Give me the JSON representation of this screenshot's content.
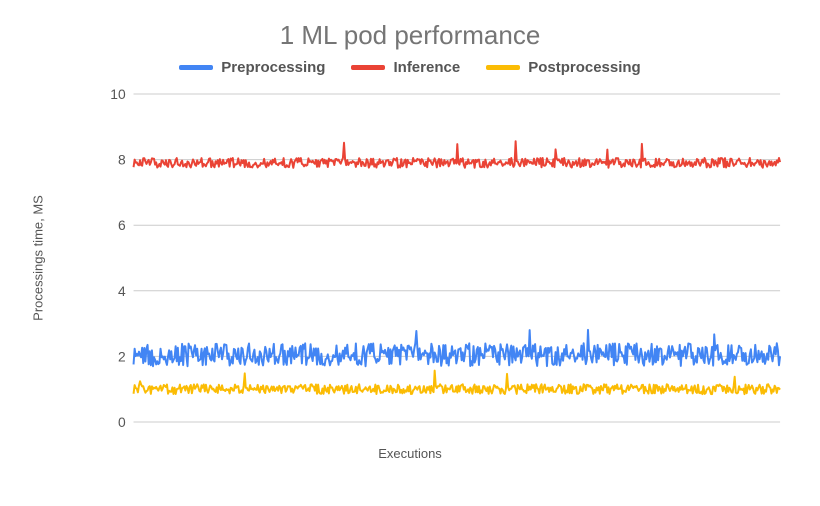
{
  "chart_data": {
    "type": "line",
    "title": "1 ML pod performance",
    "xlabel": "Executions",
    "ylabel": "Processings time, MS",
    "ylim": [
      0,
      10
    ],
    "yticks": [
      0,
      2,
      4,
      6,
      8,
      10
    ],
    "n_points": 600,
    "series": [
      {
        "name": "Preprocessing",
        "color": "#4285F4",
        "baseline": 2.05,
        "noise": 0.35,
        "spike_prob": 0.01,
        "spike_mag": 0.8
      },
      {
        "name": "Inference",
        "color": "#EA4335",
        "baseline": 7.9,
        "noise": 0.15,
        "spike_prob": 0.008,
        "spike_mag": 0.7
      },
      {
        "name": "Postprocessing",
        "color": "#FBBC04",
        "baseline": 1.0,
        "noise": 0.15,
        "spike_prob": 0.008,
        "spike_mag": 0.5
      }
    ],
    "legend": {
      "items": [
        "Preprocessing",
        "Inference",
        "Postprocessing"
      ],
      "position": "top"
    },
    "grid": true
  }
}
